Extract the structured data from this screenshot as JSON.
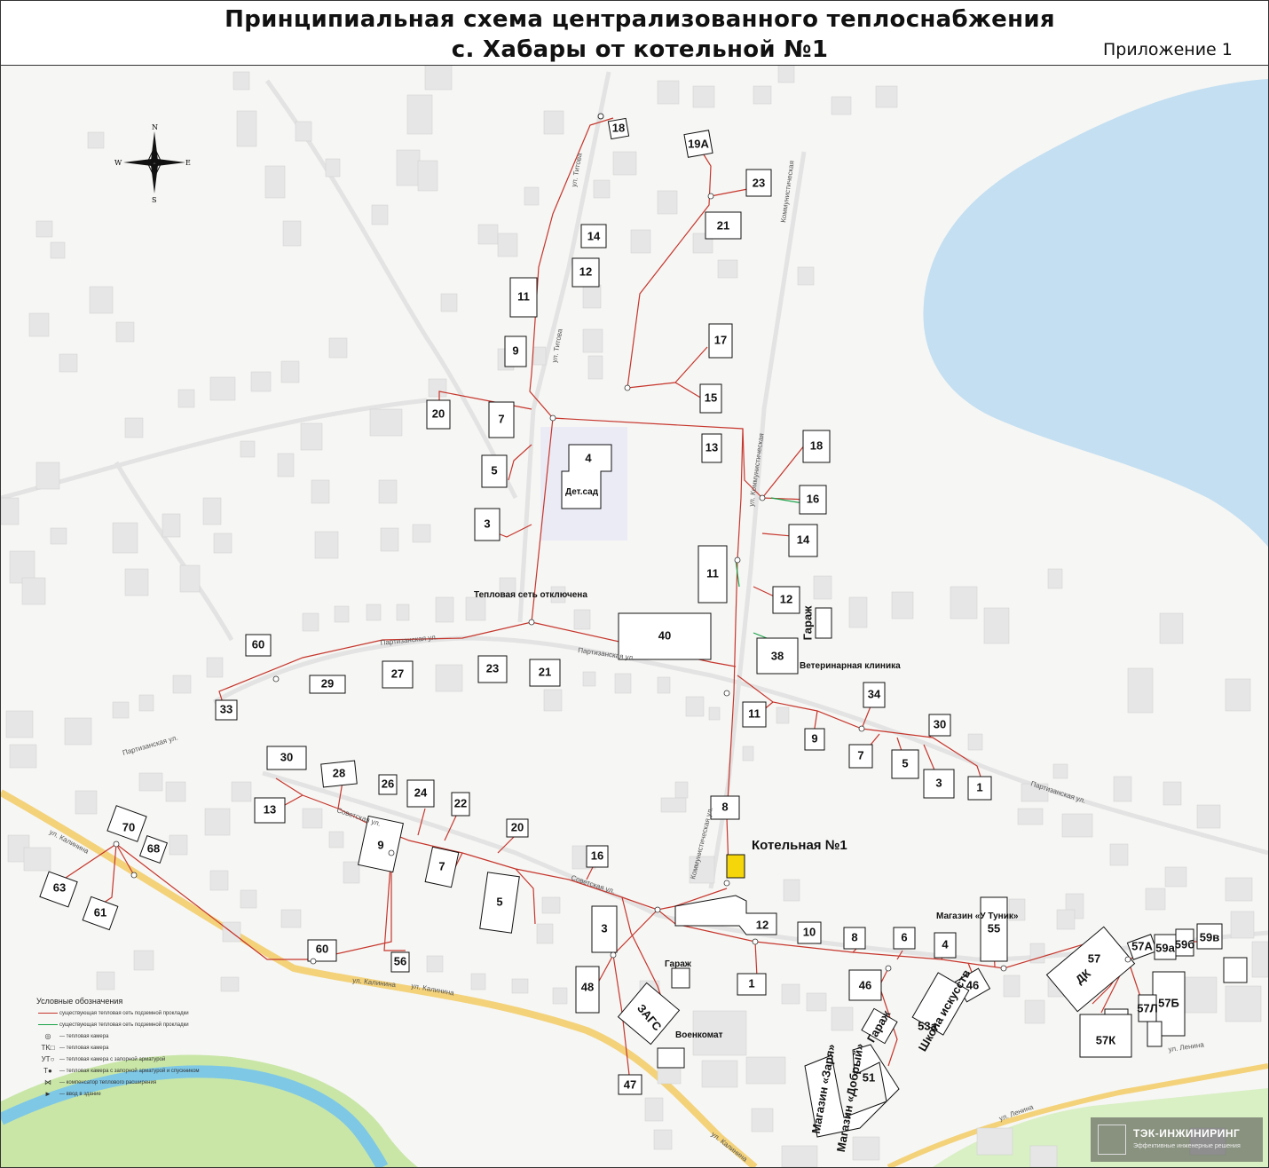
{
  "title": {
    "line1": "Принципиальная схема централизованного теплоснабжения",
    "line2": "с. Хабары от котельной №1",
    "appendix": "Приложение 1"
  },
  "compass": {
    "n": "N",
    "s": "S",
    "w": "W",
    "e": "E"
  },
  "boiler_label": "Котельная №1",
  "colors": {
    "pipe_main": "#c6362c",
    "pipe_alt": "#1aa34a",
    "boiler": "#f5d60a",
    "water": "#c3dff1",
    "river": "#7ec8e6",
    "river_bank": "#b6dd87",
    "road": "#f3d27a"
  },
  "streets": {
    "partizanskaya_w": "Партизанская ул.",
    "partizanskaya_c": "Партизанская ул.",
    "partizanskaya_e": "Партизанская ул.",
    "sovetskaya_w": "Советская ул.",
    "sovetskaya_c": "Советская ул.",
    "kalinina_w": "ул. Калинина",
    "kalinina_c": "ул. Калинина",
    "kalinina_s": "ул. Калинина",
    "titova_n": "ул. Титова",
    "titova_s": "ул. Титова",
    "kommunisticheskaya_n": "Коммунистическая",
    "kommunisticheskaya_c": "ул. Коммунистическая",
    "kommunisticheskaya_s": "Коммунистическая ул.",
    "lenina": "ул. Ленина",
    "lenina2": "ул. Ленина"
  },
  "labels": {
    "heating_net_disabled": "Тепловая сеть отключена",
    "vet_clinic": "Ветеринарная клиника",
    "garage": "Гараж",
    "garage2": "Гараж",
    "garage3": "Гараж",
    "voenkomat": "Военкомат",
    "zags": "ЗАГС",
    "dk": "ДК",
    "detsad": "Дет.сад",
    "shop_tunik": "Магазин «У Туник»",
    "music_school": "Школа искусств",
    "shop_chp": "Магазин «Заря»",
    "shop_kal": "Магазин «Добрый»"
  },
  "buildings": [
    "18",
    "19А",
    "23",
    "21",
    "14",
    "12",
    "11",
    "9",
    "17",
    "15",
    "13",
    "20",
    "7",
    "4",
    "5",
    "3",
    "18",
    "16",
    "14",
    "11",
    "12",
    "40",
    "38",
    "34",
    "30",
    "11",
    "9",
    "7",
    "5",
    "3",
    "1",
    "60",
    "29",
    "27",
    "23",
    "21",
    "33",
    "30",
    "28",
    "26",
    "24",
    "22",
    "13",
    "20",
    "9",
    "7",
    "16",
    "5",
    "8",
    "3",
    "12",
    "10",
    "8",
    "6",
    "4",
    "55",
    "70",
    "68",
    "63",
    "61",
    "60",
    "56",
    "48",
    "46",
    "47",
    "1",
    "57",
    "57А",
    "59а",
    "59б",
    "59в",
    "57Б",
    "57К",
    "57Л",
    "46",
    "53а",
    "51"
  ],
  "legend": {
    "title": "Условные обозначения",
    "items": [
      "существующая тепловая сеть подземной прокладки",
      "существующая тепловая сеть подземной прокладки",
      "— тепловая камера",
      "— тепловая камера",
      "— тепловая камера с запорной арматурой",
      "— тепловая камера с запорной арматурой и спускником",
      "— компенсатор теплового расширения",
      "— ввод в здание"
    ]
  },
  "logo": {
    "name": "ТЭК-ИНЖИНИРИНГ",
    "tagline": "Эффективные инженерные решения"
  }
}
